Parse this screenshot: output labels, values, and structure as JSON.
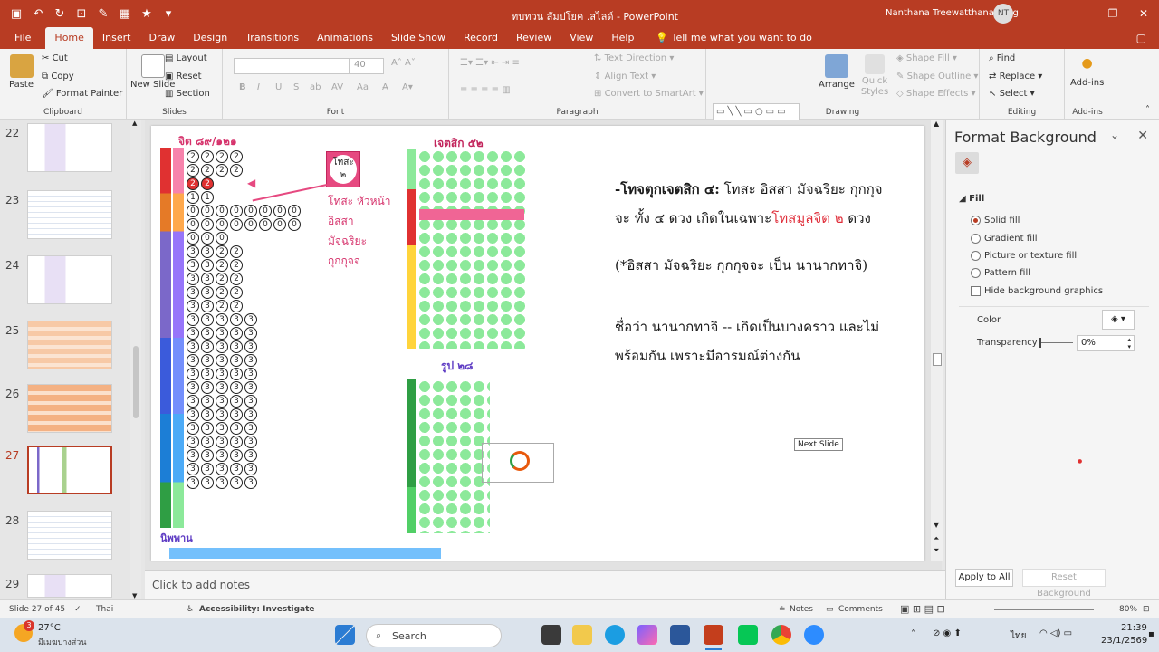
{
  "window": {
    "title": "ทบทวน สัมปโยค .สไลด์  -  PowerPoint",
    "user": "Nanthana Treewatthanawong",
    "user_initials": "NT"
  },
  "tabs": [
    "File",
    "Home",
    "Insert",
    "Draw",
    "Design",
    "Transitions",
    "Animations",
    "Slide Show",
    "Record",
    "Review",
    "View",
    "Help"
  ],
  "tell_me": "Tell me what you want to do",
  "ribbon": {
    "clipboard": {
      "paste": "Paste",
      "cut": "Cut",
      "copy": "Copy",
      "format_painter": "Format Painter",
      "label": "Clipboard"
    },
    "slides": {
      "new_slide": "New Slide",
      "layout": "Layout",
      "reset": "Reset",
      "section": "Section",
      "label": "Slides"
    },
    "font": {
      "size": "40",
      "label": "Font",
      "buttons": [
        "B",
        "I",
        "U",
        "S",
        "ab",
        "AV",
        "Aa"
      ]
    },
    "paragraph": {
      "text_direction": "Text Direction",
      "align_text": "Align Text",
      "convert": "Convert to SmartArt",
      "label": "Paragraph"
    },
    "drawing": {
      "arrange": "Arrange",
      "quick_styles": "Quick Styles",
      "shape_fill": "Shape Fill",
      "shape_outline": "Shape Outline",
      "shape_effects": "Shape Effects",
      "label": "Drawing"
    },
    "editing": {
      "find": "Find",
      "replace": "Replace",
      "select": "Select",
      "label": "Editing"
    },
    "addins": {
      "addins": "Add-ins",
      "label": "Add-ins"
    }
  },
  "thumbnails": [
    {
      "num": "22",
      "selected": false
    },
    {
      "num": "23",
      "selected": false
    },
    {
      "num": "24",
      "selected": false
    },
    {
      "num": "25",
      "selected": false
    },
    {
      "num": "26",
      "selected": false
    },
    {
      "num": "27",
      "selected": true
    },
    {
      "num": "28",
      "selected": false
    },
    {
      "num": "29",
      "selected": false
    }
  ],
  "slide": {
    "line1a": "-โทจตุกเจตสิก ๔:",
    "line1b": " โทสะ อิสสา มัจฉริยะ กุกกุจ",
    "line2a": "จะ ทั้ง ๔ ดวง เกิดในเฉพาะ",
    "line2b": "โทสมูลจิต ๒",
    "line2c": " ดวง",
    "line3": "(*อิสสา มัจฉริยะ กุกกุจจะ เป็น นานากทาจิ)",
    "line4": "ชื่อว่า นานากทาจิ -- เกิดเป็นบางคราว และไม่",
    "line5": "พร้อมกัน เพราะมีอารมณ์ต่างกัน",
    "chart_header_left": "จิต ๘๙/๑๒๑",
    "chart_header_mid": "เจตสิก ๕๒",
    "chart_rupa": "รูป ๒๘",
    "chart_nibbana": "นิพพาน",
    "chart_box": "โทสะ ๒",
    "chart_box_caption": [
      "โทสะ หัวหน้า",
      "อิสสา",
      "มัจฉริยะ",
      "กุกกุจจ"
    ],
    "tooltip": "Next Slide"
  },
  "notes_placeholder": "Click to add notes",
  "format_background": {
    "title": "Format Background",
    "section": "Fill",
    "options": [
      {
        "label": "Solid fill",
        "selected": true
      },
      {
        "label": "Gradient fill",
        "selected": false
      },
      {
        "label": "Picture or texture fill",
        "selected": false
      },
      {
        "label": "Pattern fill",
        "selected": false
      }
    ],
    "hide_graphics": "Hide background graphics",
    "color_label": "Color",
    "transparency_label": "Transparency",
    "transparency_value": "0%",
    "apply_all": "Apply to All",
    "reset": "Reset Background"
  },
  "status": {
    "slide": "Slide 27 of 45",
    "language": "Thai",
    "accessibility": "Accessibility: Investigate",
    "notes": "Notes",
    "comments": "Comments",
    "zoom": "80%"
  },
  "taskbar": {
    "weather_temp": "27°C",
    "weather_desc": "มีเมฆบางส่วน",
    "weather_badge": "3",
    "search": "Search",
    "lang": "ไทย",
    "time": "21:39",
    "date": "23/1/2569"
  },
  "colors": {
    "accent": "#b83c23",
    "red_text": "#e0303c"
  }
}
